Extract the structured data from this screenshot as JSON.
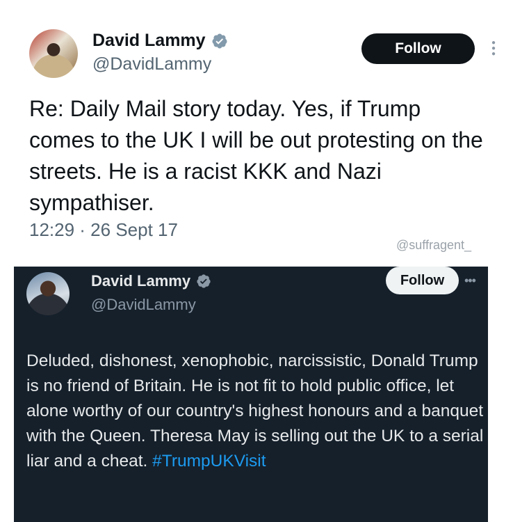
{
  "top_tweet": {
    "display_name": "David Lammy",
    "handle": "@DavidLammy",
    "follow_label": "Follow",
    "text": "Re: Daily Mail story today. Yes, if Trump comes to the UK I will be out protesting on the streets. He is a racist KKK and Nazi sympathiser.",
    "timestamp": "12:29 · 26 Sept 17",
    "more_icon": "more-vertical-icon",
    "verified_icon": "verified-badge-icon"
  },
  "watermark": "@suffragent_",
  "embedded_tweet": {
    "display_name": "David Lammy",
    "handle": "@DavidLammy",
    "follow_label": "Follow",
    "text": "Deluded, dishonest, xenophobic, narcissistic, Donald Trump is no friend of Britain. He is not fit to hold public office, let alone worthy of our country's highest honours and a banquet with the Queen. Theresa May is selling out the UK to a serial liar and a cheat. ",
    "hashtag": "#TrumpUKVisit",
    "more_icon": "more-horizontal-icon",
    "verified_icon": "verified-badge-icon"
  },
  "colors": {
    "verified": "#1d9bf0",
    "hashtag": "#1d9bf0",
    "dark_background": "#15202b"
  }
}
